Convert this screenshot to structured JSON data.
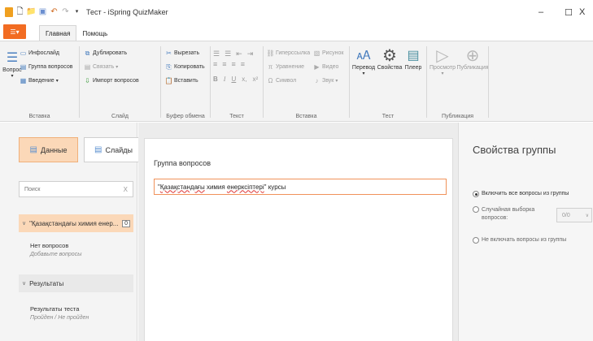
{
  "titlebar": {
    "title": "Тест - iSpring QuizMaker",
    "icons": [
      "app-logo",
      "new-document-icon",
      "open-folder-icon",
      "save-icon",
      "undo-icon",
      "redo-icon",
      "customize-arrow-icon"
    ],
    "minimize": "–",
    "maximize": "☐",
    "close": "X"
  },
  "tabs": {
    "file_label": "☰▾",
    "items": [
      {
        "label": "Главная",
        "active": true
      },
      {
        "label": "Помощь",
        "active": false
      }
    ]
  },
  "ribbon": {
    "groups": {
      "insert1": {
        "label": "Вставка",
        "question": "Вопрос",
        "info_slide": "Инфослайд",
        "question_group": "Группа вопросов",
        "intro": "Введение"
      },
      "slide": {
        "label": "Слайд",
        "duplicate": "Дублировать",
        "link": "Связать",
        "import": "Импорт вопросов"
      },
      "clipboard": {
        "label": "Буфер обмена",
        "cut": "Вырезать",
        "copy": "Копировать",
        "paste": "Вставить"
      },
      "text": {
        "label": "Текст",
        "bold": "B",
        "italic": "I",
        "underline": "U",
        "sub": "x,",
        "sup": "x²"
      },
      "insert2": {
        "label": "Вставка",
        "hyperlink": "Гиперссылка",
        "equation": "Уравнение",
        "symbol": "Символ",
        "picture": "Рисунок",
        "video": "Видео",
        "audio": "Звук"
      },
      "test": {
        "label": "Тест",
        "translate": "Перевод",
        "properties": "Свойства",
        "player": "Плеер"
      },
      "publish": {
        "label": "Публикация",
        "preview": "Просмотр",
        "publish": "Публикация"
      }
    }
  },
  "left_panel": {
    "tab_data": "Данные",
    "tab_slides": "Слайды",
    "search_placeholder": "Поиск",
    "search_clear": "X",
    "group_name": "\"Қазақстандағы химия енер...",
    "group_count": "0",
    "no_questions": "Нет вопросов",
    "add_questions": "Добавьте вопросы",
    "results_label": "Результаты",
    "results_item": "Результаты теста",
    "results_sub": "Пройден / Не пройден"
  },
  "main": {
    "card_title": "Группа вопросов",
    "name_prefix": "\"",
    "name_word1": "Қазақстандағы",
    "name_sep1": " химия ",
    "name_word2": "енерксіптері",
    "name_suffix": "\" курсы"
  },
  "right_panel": {
    "title": "Свойства группы",
    "opt_all": "Включить все вопросы из группы",
    "opt_random": "Случайная выборка вопросов:",
    "random_value": "0/0",
    "opt_exclude": "Не включать вопросы из группы"
  },
  "colors": {
    "accent": "#f26c22",
    "selected": "#fbd8b8",
    "input_border": "#f0925a"
  }
}
